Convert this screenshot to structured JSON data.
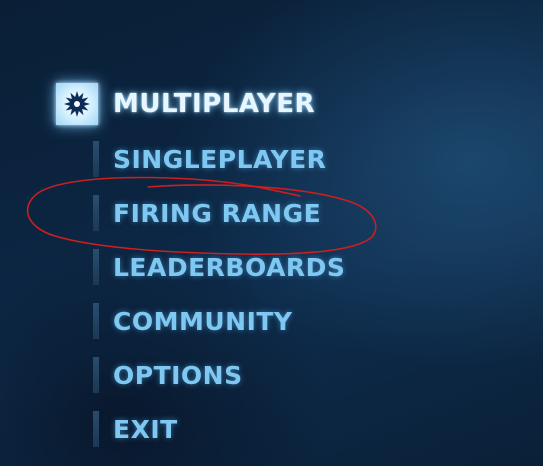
{
  "menu": {
    "items": [
      {
        "label": "MULTIPLAYER",
        "active": true
      },
      {
        "label": "SINGLEPLAYER"
      },
      {
        "label": "FIRING RANGE"
      },
      {
        "label": "LEADERBOARDS"
      },
      {
        "label": "COMMUNITY"
      },
      {
        "label": "OPTIONS"
      },
      {
        "label": "EXIT"
      }
    ],
    "active_icon": "starburst-icon"
  },
  "annotation": {
    "color": "#cc1f1f",
    "target": "FIRING RANGE"
  },
  "colors": {
    "menu_text": "#7ec8f2",
    "active_text": "#e8f6ff"
  }
}
